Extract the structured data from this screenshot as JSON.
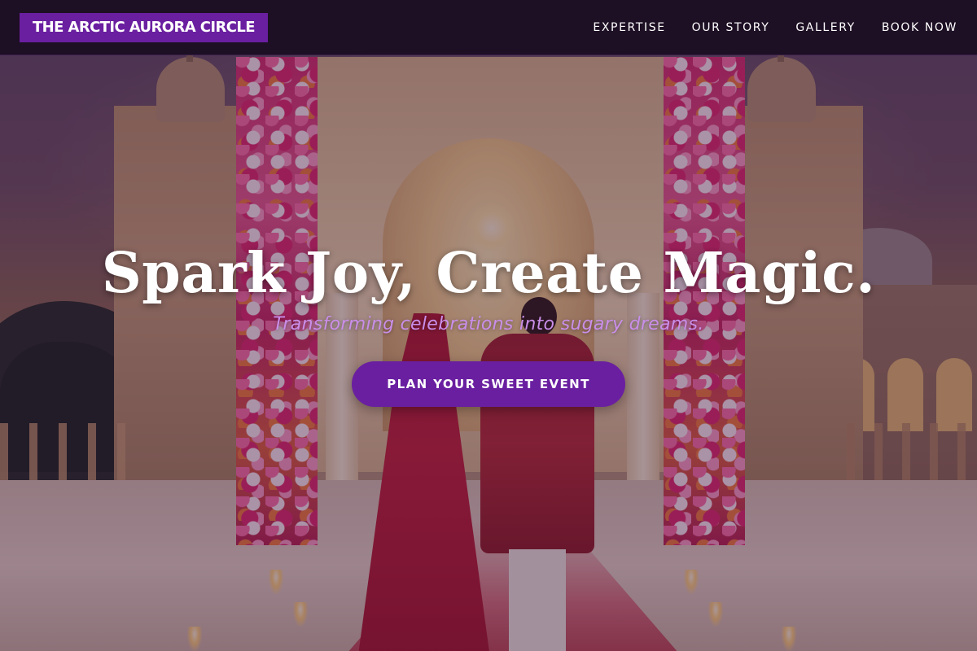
{
  "navbar": {
    "brand": "THE ARCTIC AURORA CIRCLE",
    "links": [
      {
        "label": "EXPERTISE"
      },
      {
        "label": "OUR STORY"
      },
      {
        "label": "GALLERY"
      },
      {
        "label": "BOOK NOW"
      }
    ]
  },
  "hero": {
    "title": "Spark Joy, Create Magic.",
    "subtitle": "Transforming celebrations into sugary dreams.",
    "cta_label": "PLAN YOUR SWEET EVENT"
  },
  "colors": {
    "brand_purple": "#6a1fa0",
    "navbar_bg": "#1d0f24",
    "subtitle": "#c98ee8",
    "text": "#ffffff"
  }
}
